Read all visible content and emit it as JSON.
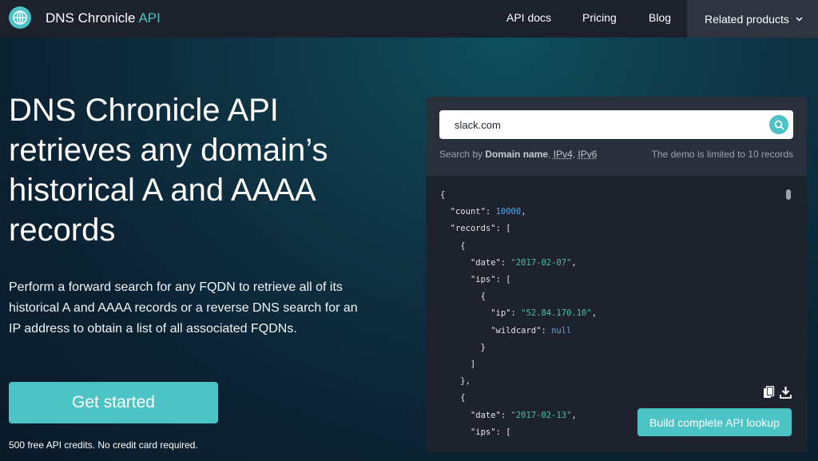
{
  "nav": {
    "brand_name": "DNS Chronicle",
    "brand_suffix": "API",
    "links": [
      "API docs",
      "Pricing",
      "Blog"
    ],
    "related": "Related products"
  },
  "hero": {
    "title": "DNS Chronicle API retrieves any domain’s historical A and AAAA records",
    "description": "Perform a forward search for any FQDN to retrieve all of its historical A and AAAA records or a reverse DNS search for an IP address to obtain a list of all associated FQDNs.",
    "cta": "Get started",
    "note": "500 free API credits. No credit card required."
  },
  "demo": {
    "search_value": "slack.com",
    "hint_prefix": "Search by",
    "hint_domain": "Domain name",
    "hint_ipv4": "IPv4",
    "hint_ipv6": "IPv6",
    "limit_note": "The demo is limited to 10 records",
    "build_button": "Build complete API lookup",
    "json": {
      "count_key": "\"count\"",
      "count_value": "10000",
      "records_key": "\"records\"",
      "date_key": "\"date\"",
      "date1": "\"2017-02-07\"",
      "ips_key": "\"ips\"",
      "ip_key": "\"ip\"",
      "ip1": "\"52.84.170.10\"",
      "wildcard_key": "\"wildcard\"",
      "wildcard_value": "null",
      "date2": "\"2017-02-13\""
    }
  },
  "icons": {
    "logo": "globe-icon",
    "search": "search-icon",
    "copy": "copy-icon",
    "download": "download-icon",
    "dropdown": "chevron-down-icon"
  },
  "colors": {
    "accent": "#4cc3c4",
    "nav_bg": "#1c212b",
    "panel_bg": "#1d222c",
    "json_string": "#4cc3a4",
    "json_number": "#5aa6e8"
  }
}
